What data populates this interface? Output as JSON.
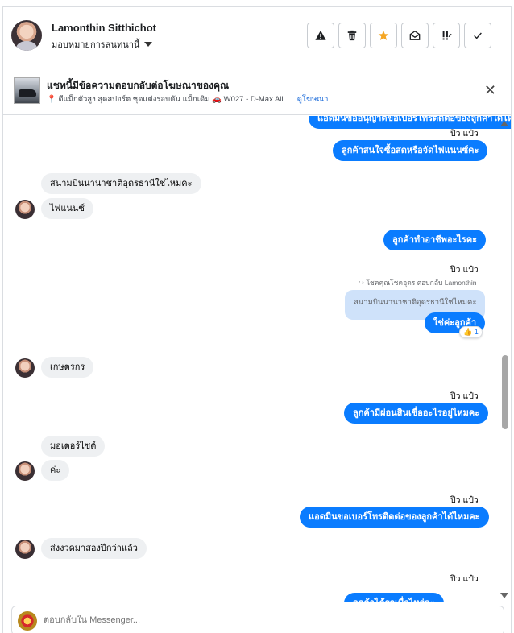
{
  "header": {
    "user_name": "Lamonthin Sitthichot",
    "assign_label": "มอบหมายการสนทนานี้",
    "tools": [
      {
        "icon": "warning-icon",
        "glyph": "⚠"
      },
      {
        "icon": "trash-icon",
        "glyph": "🗑"
      },
      {
        "icon": "star-icon",
        "glyph": "★"
      },
      {
        "icon": "envelope-open-icon",
        "glyph": "✉"
      },
      {
        "icon": "priority-icon",
        "glyph": "!!"
      },
      {
        "icon": "check-icon",
        "glyph": "✓"
      }
    ]
  },
  "banner": {
    "title": "แชทนี้มีข้อความตอบกลับต่อโฆษณาของคุณ",
    "subtitle": "ดีแม็กตัวสูง สุดสปอร์ต ชุดแต่งรอบคัน แม็กเดิม",
    "model": "W027 - D-Max All ...",
    "link": "ดูโฆษณา",
    "close": "✕"
  },
  "messages": {
    "m0": "แอดมินขออนุญาตขอเบอร์โทรติดต่อของลูกค้าได้ไหมคะ",
    "t1": "ปีว แป๋ว",
    "m1": "ลูกค้าสนใจซื้อสดหรือจัดไฟแนนซ์คะ",
    "m2": "สนามบินนานาชาติอุดรธานีใช่ไหมคะ",
    "m3": "ไฟแนนซ์",
    "m4": "ลูกค้าทำอาชีพอะไรคะ",
    "t2": "ปีว แป๋ว",
    "reply_note": "↪ โชคคุณโชคอุดร ตอบกลับ Lamonthin",
    "quoted": "สนามบินนานาชาติอุดรธานีใช่ไหมคะ",
    "m5": "ใช่ค่ะลูกค้า",
    "reaction": "👍 1",
    "m6": "เกษตรกร",
    "t3": "ปีว แป๋ว",
    "m7": "ลูกค้ามีผ่อนสินเชื่ออะไรอยู่ไหมคะ",
    "m8": "มอเตอร์ไซต์",
    "m9": "ค่ะ",
    "t4": "ปีว แป๋ว",
    "m10": "แอดมินขอเบอร์โทรติดต่อของลูกค้าได้ไหมคะ",
    "m11": "ส่งงวดมาสองปีกว่าแล้ว",
    "t5": "ปีว แป๋ว",
    "m12": "ลูกค้าได้รถเมื่อไหร่คะ"
  },
  "composer": {
    "placeholder": "ตอบกลับใน Messenger..."
  }
}
